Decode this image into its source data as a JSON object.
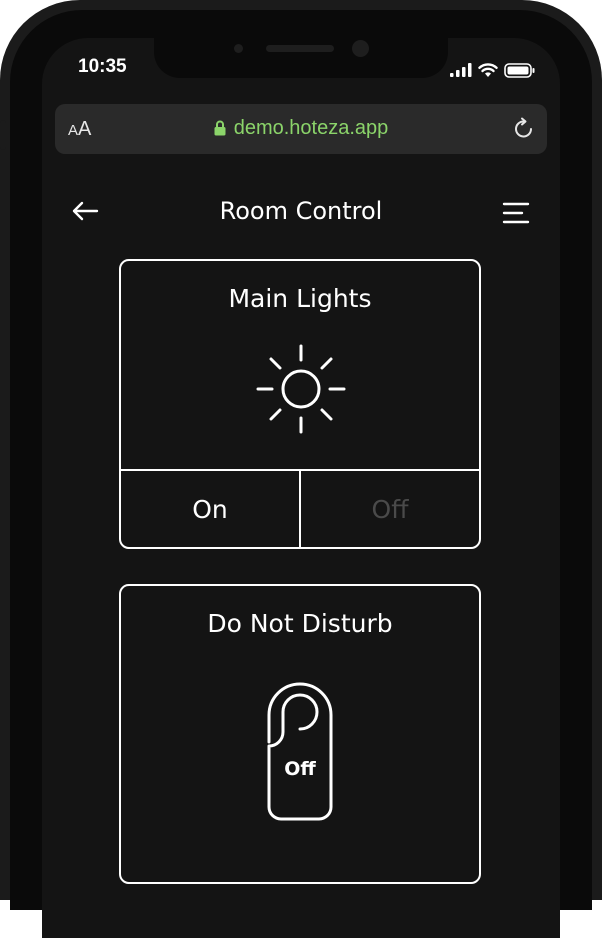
{
  "status_bar": {
    "time": "10:35"
  },
  "browser": {
    "text_size_label_small": "A",
    "text_size_label_large": "A",
    "url": "demo.hoteza.app"
  },
  "nav": {
    "title": "Room Control"
  },
  "lights": {
    "title": "Main Lights",
    "on_label": "On",
    "off_label": "Off",
    "selected": "On"
  },
  "dnd": {
    "title": "Do Not Disturb",
    "state_label": "Off"
  },
  "colors": {
    "url_text": "#8bd46a",
    "inactive_option": "#4a4a4a"
  }
}
